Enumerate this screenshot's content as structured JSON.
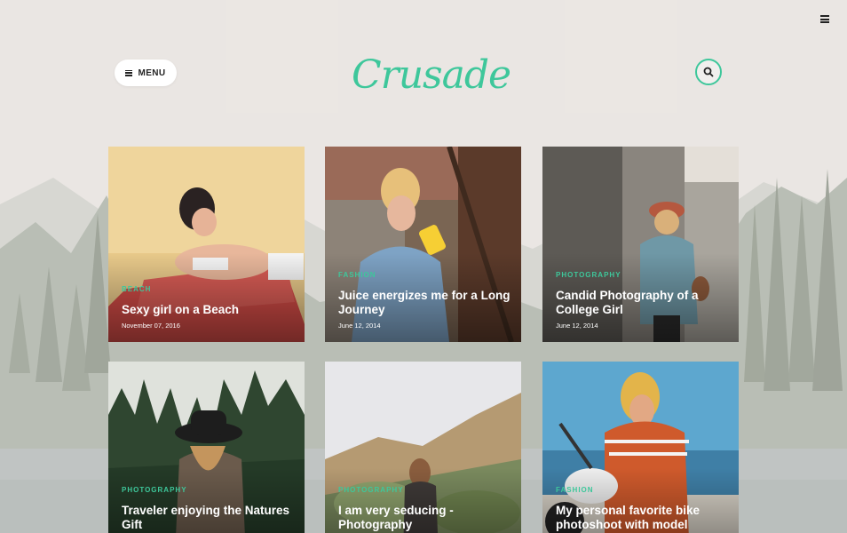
{
  "header": {
    "menu_label": "MENU",
    "logo_text": "Crusade"
  },
  "posts": [
    {
      "category": "BEACH",
      "title": "Sexy girl on a Beach",
      "date": "November 07, 2016"
    },
    {
      "category": "FASHION",
      "title": "Juice energizes me for a Long Journey",
      "date": "June 12, 2014"
    },
    {
      "category": "PHOTOGRAPHY",
      "title": "Candid Photography of a College Girl",
      "date": "June 12, 2014"
    },
    {
      "category": "PHOTOGRAPHY",
      "title": "Traveler enjoying the Natures Gift",
      "date": ""
    },
    {
      "category": "PHOTOGRAPHY",
      "title": "I am very seducing - Photography",
      "date": ""
    },
    {
      "category": "FASHION",
      "title": "My personal favorite bike photoshoot with model",
      "date": ""
    }
  ],
  "colors": {
    "accent": "#3ec79b",
    "text_light": "#ffffff",
    "text_dark": "#222222"
  },
  "icons": {
    "menu": "hamburger-icon",
    "search": "search-icon",
    "page_menu": "hamburger-icon"
  }
}
